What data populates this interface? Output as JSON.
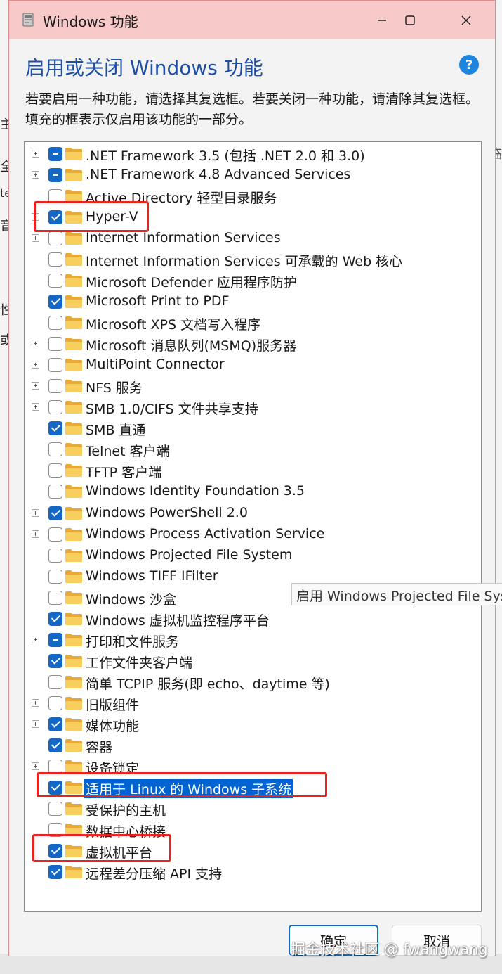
{
  "window": {
    "title": "Windows 功能"
  },
  "header": {
    "heading": "启用或关闭 Windows 功能",
    "help_icon": "?",
    "description": "若要启用一种功能，请选择其复选框。若要关闭一种功能，请清除其复选框。填充的框表示仅启用该功能的一部分。"
  },
  "features": [
    {
      "label": ".NET Framework 3.5 (包括 .NET 2.0 和 3.0)",
      "state": "partial",
      "expandable": true
    },
    {
      "label": ".NET Framework 4.8 Advanced Services",
      "state": "partial",
      "expandable": true
    },
    {
      "label": "Active Directory 轻型目录服务",
      "state": "unchecked",
      "expandable": false
    },
    {
      "label": "Hyper-V",
      "state": "checked",
      "expandable": true
    },
    {
      "label": "Internet Information Services",
      "state": "unchecked",
      "expandable": true
    },
    {
      "label": "Internet Information Services 可承载的 Web 核心",
      "state": "unchecked",
      "expandable": false
    },
    {
      "label": "Microsoft Defender 应用程序防护",
      "state": "unchecked",
      "expandable": false
    },
    {
      "label": "Microsoft Print to PDF",
      "state": "checked",
      "expandable": false
    },
    {
      "label": "Microsoft XPS 文档写入程序",
      "state": "unchecked",
      "expandable": false
    },
    {
      "label": "Microsoft 消息队列(MSMQ)服务器",
      "state": "unchecked",
      "expandable": true
    },
    {
      "label": "MultiPoint Connector",
      "state": "unchecked",
      "expandable": true
    },
    {
      "label": "NFS 服务",
      "state": "unchecked",
      "expandable": true
    },
    {
      "label": "SMB 1.0/CIFS 文件共享支持",
      "state": "unchecked",
      "expandable": true
    },
    {
      "label": "SMB 直通",
      "state": "checked",
      "expandable": false
    },
    {
      "label": "Telnet 客户端",
      "state": "unchecked",
      "expandable": false
    },
    {
      "label": "TFTP 客户端",
      "state": "unchecked",
      "expandable": false
    },
    {
      "label": "Windows Identity Foundation 3.5",
      "state": "unchecked",
      "expandable": false
    },
    {
      "label": "Windows PowerShell 2.0",
      "state": "checked",
      "expandable": true
    },
    {
      "label": "Windows Process Activation Service",
      "state": "unchecked",
      "expandable": true
    },
    {
      "label": "Windows Projected File System",
      "state": "unchecked",
      "expandable": false
    },
    {
      "label": "Windows TIFF IFilter",
      "state": "unchecked",
      "expandable": false
    },
    {
      "label": "Windows 沙盒",
      "state": "unchecked",
      "expandable": false
    },
    {
      "label": "Windows 虚拟机监控程序平台",
      "state": "checked",
      "expandable": false
    },
    {
      "label": "打印和文件服务",
      "state": "partial",
      "expandable": true
    },
    {
      "label": "工作文件夹客户端",
      "state": "checked",
      "expandable": false
    },
    {
      "label": "简单 TCPIP 服务(即 echo、daytime 等)",
      "state": "unchecked",
      "expandable": false
    },
    {
      "label": "旧版组件",
      "state": "unchecked",
      "expandable": true
    },
    {
      "label": "媒体功能",
      "state": "checked",
      "expandable": true
    },
    {
      "label": "容器",
      "state": "checked",
      "expandable": false
    },
    {
      "label": "设备锁定",
      "state": "unchecked",
      "expandable": true
    },
    {
      "label": "适用于 Linux 的 Windows 子系统",
      "state": "checked",
      "expandable": false,
      "selected": true
    },
    {
      "label": "受保护的主机",
      "state": "unchecked",
      "expandable": false
    },
    {
      "label": "数据中心桥接",
      "state": "unchecked",
      "expandable": false
    },
    {
      "label": "虚拟机平台",
      "state": "checked",
      "expandable": false
    },
    {
      "label": "远程差分压缩 API 支持",
      "state": "checked",
      "expandable": false
    }
  ],
  "tooltip": "启用 Windows Projected File System",
  "buttons": {
    "ok": "确定",
    "cancel": "取消"
  },
  "watermark": "掘金技术社区 @ fwangwang",
  "background": {
    "left_chars": [
      "主",
      "全",
      "te",
      "音",
      "性",
      "或"
    ],
    "right_chars": [
      "临"
    ]
  },
  "colors": {
    "title_bar": "#f7c9c9",
    "heading": "#1e4fa8",
    "checkbox": "#1467c5",
    "selection": "#0063d1",
    "highlight": "#e8231f"
  }
}
